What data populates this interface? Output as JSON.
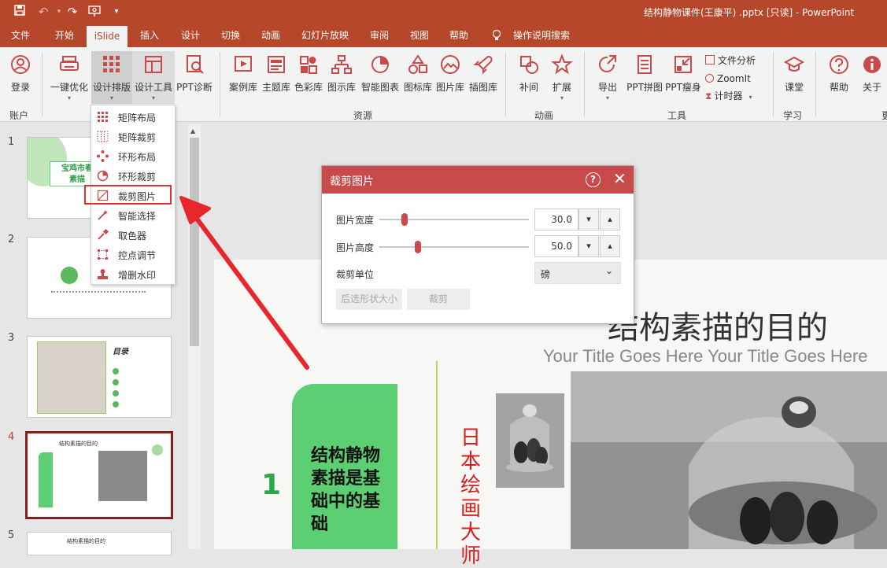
{
  "titlebar": {
    "doc_title": "结构静物课件(王康平) .pptx [只读]  -  PowerPoint"
  },
  "menu_tabs": [
    "文件",
    "开始",
    "iSlide",
    "插入",
    "设计",
    "切换",
    "动画",
    "幻灯片放映",
    "审阅",
    "视图",
    "帮助",
    "操作说明搜索"
  ],
  "ribbon": {
    "buttons": {
      "login": "登录",
      "optimize": "一键优化",
      "layout": "设计排版",
      "tools": "设计工具",
      "diagnose": "PPT诊断",
      "cases": "案例库",
      "themes": "主题库",
      "colors": "色彩库",
      "diagrams": "图示库",
      "smartchart": "智能图表",
      "icons": "图标库",
      "pictures": "图片库",
      "illustrations": "插图库",
      "tween": "补间",
      "extend": "扩展",
      "export": "导出",
      "stitch": "PPT拼图",
      "slim": "PPT瘦身",
      "file_analysis": "文件分析",
      "zoomit": "ZoomIt",
      "timer": "计时器",
      "course": "课堂",
      "help": "帮助",
      "about": "关于"
    },
    "groups": {
      "account": "账户",
      "resources": "资源",
      "animation": "动画",
      "tools": "工具",
      "learning": "学习",
      "cutoff": "更"
    }
  },
  "dropdown": {
    "items": [
      "矩阵布局",
      "矩阵裁剪",
      "环形布局",
      "环形裁剪",
      "裁剪图片",
      "智能选择",
      "取色器",
      "控点调节",
      "增删水印"
    ]
  },
  "slides": {
    "numbers": [
      "1",
      "2",
      "3",
      "4",
      "5"
    ],
    "selected": "4",
    "thumb1_title": "宝鸡市春\n素描",
    "thumb3_heading": "目录",
    "thumb4_title": "结构素描的目的",
    "thumb5_title": "结构素描的目的"
  },
  "dialog": {
    "title": "裁剪图片",
    "width_label": "图片宽度",
    "width_value": "30.0",
    "width_ratio": 0.17,
    "height_label": "图片高度",
    "height_value": "50.0",
    "height_ratio": 0.26,
    "unit_label": "裁剪单位",
    "unit_value": "磅",
    "shape_size_button": "后选形状大小",
    "crop_button": "裁剪"
  },
  "slide": {
    "title": "结构素描的目的",
    "subtitle": "Your Title Goes Here Your Title Goes Here",
    "number": "1",
    "box_text": "结构静物\n素描是基\n础中的基\n础",
    "vertical_text": "日本绘画大师"
  },
  "colors": {
    "accent": "#b7472a",
    "dialog_header": "#c94a4a",
    "green": "#5ccf73",
    "highlight": "#e03030"
  }
}
